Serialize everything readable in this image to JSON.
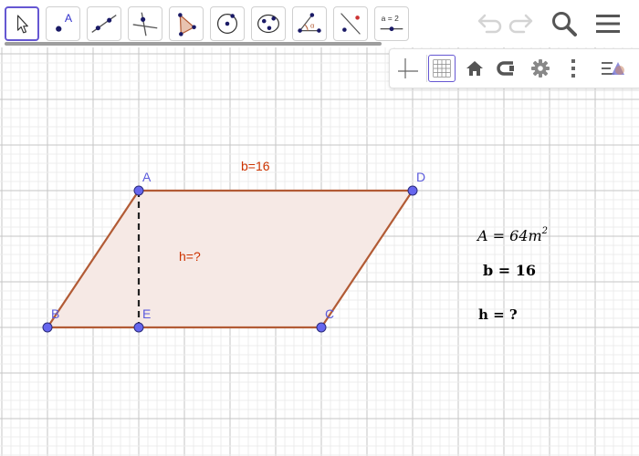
{
  "toolbar": {
    "tools": [
      {
        "name": "move-tool",
        "selected": true
      },
      {
        "name": "point-tool",
        "label": "A"
      },
      {
        "name": "line-tool"
      },
      {
        "name": "perpendicular-line-tool"
      },
      {
        "name": "polygon-tool"
      },
      {
        "name": "circle-tool"
      },
      {
        "name": "conic-tool"
      },
      {
        "name": "angle-tool"
      },
      {
        "name": "reflect-tool"
      },
      {
        "name": "slider-tool",
        "label": "a = 2"
      }
    ],
    "actions": [
      "undo-icon",
      "redo-icon",
      "search-icon",
      "menu-icon"
    ]
  },
  "style_bar": {
    "buttons": [
      "axes-icon",
      "grid-icon",
      "home-icon",
      "view-icon",
      "gear-icon",
      "more-icon",
      "algebra-toggle-icon"
    ],
    "active": "grid-icon"
  },
  "construction": {
    "points": [
      {
        "id": "A",
        "label": "A"
      },
      {
        "id": "B",
        "label": "B"
      },
      {
        "id": "C",
        "label": "C"
      },
      {
        "id": "D",
        "label": "D"
      },
      {
        "id": "E",
        "label": "E"
      }
    ],
    "captions": {
      "base": "b=16",
      "height": "h=?"
    }
  },
  "info": {
    "area": {
      "var": "A",
      "eq": " = 64",
      "unit": "m",
      "exp": "2"
    },
    "base": "b = 16",
    "height": "h = ?"
  },
  "colors": {
    "polygon_stroke": "#b25b35",
    "polygon_fill": "#f6e9e5",
    "point": "#6666ee",
    "point_label": "#5b5bdc",
    "caption": "#cc3300",
    "grid_minor": "#ececec",
    "grid_major": "#c6c6c6",
    "selected_tool": "#6557d2"
  }
}
